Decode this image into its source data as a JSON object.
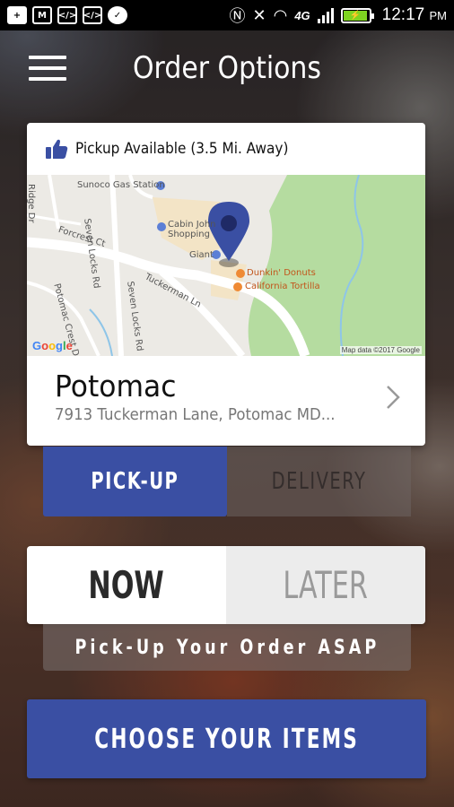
{
  "status_bar": {
    "time": "12:17",
    "ampm": "PM",
    "network": "4G",
    "battery_level": 0.95,
    "notification_icons": [
      "add-icon",
      "mail-icon",
      "code-icon",
      "code-icon",
      "messenger-icon"
    ],
    "system_icons": [
      "nfc-icon",
      "vibrate-off-icon",
      "wifi-icon",
      "4g-icon",
      "signal-icon",
      "battery-icon"
    ]
  },
  "header": {
    "title": "Order Options",
    "menu_icon": "hamburger-menu-icon"
  },
  "location_card": {
    "availability": "Pickup Available (3.5 Mi. Away)",
    "name": "Potomac",
    "address": "7913 Tuckerman Lane, Potomac MD...",
    "map": {
      "labels": {
        "sunoco": "Sunoco Gas Station",
        "cabin_john": "Cabin John",
        "shopping": "Shopping",
        "giant": "Giant",
        "dunkin": "Dunkin' Donuts",
        "california_tortilla": "California Tortilla",
        "tuckerman": "Tuckerman Ln",
        "sevenlocks1": "Seven Locks Rd",
        "sevenlocks2": "Seven Locks Rd",
        "forcrest": "Forcrest Ct",
        "potomac_crest": "Potomac Crest Dr",
        "ridge": "Ridge Dr",
        "google": "Google",
        "attribution": "Map data ©2017 Google"
      }
    }
  },
  "order_mode": {
    "pickup_label": "PICK-UP",
    "delivery_label": "DELIVERY",
    "selected": "PICK-UP"
  },
  "order_time": {
    "now_label": "NOW",
    "later_label": "LATER",
    "selected": "NOW",
    "description": "Pick-Up Your Order ASAP"
  },
  "cta": {
    "label": "CHOOSE YOUR ITEMS"
  },
  "colors": {
    "primary": "#3a4fa3",
    "map_park": "#b5dca0",
    "map_marker": "#3a4fa3",
    "status_bar": "#000000"
  }
}
